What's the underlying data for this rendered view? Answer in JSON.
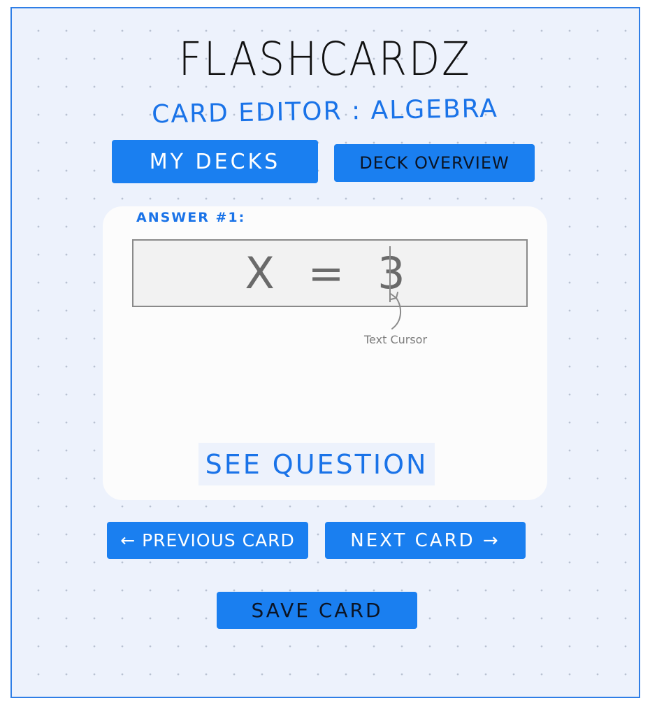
{
  "header": {
    "app_title": "FLASHCARDZ",
    "subtitle": "CARD EDITOR : ALGEBRA"
  },
  "nav": {
    "my_decks": "MY DECKS",
    "deck_overview": "DECK OVERVIEW"
  },
  "card": {
    "answer_label": "ANSWER #1:",
    "answer_value": "X = 3",
    "cursor_annotation": "Text Cursor",
    "see_question": "SEE QUESTION"
  },
  "footer": {
    "previous_card": "← PREVIOUS CARD",
    "next_card": "NEXT CARD →",
    "save_card": "SAVE CARD"
  },
  "colors": {
    "accent": "#1a7ff0",
    "background": "#edf2fc",
    "card": "#fcfcfc"
  }
}
